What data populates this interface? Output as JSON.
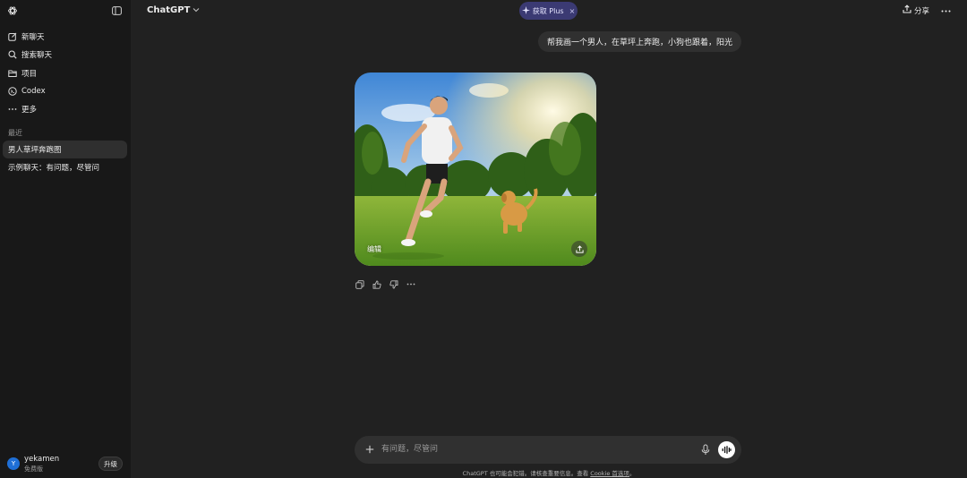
{
  "sidebar": {
    "nav_items": [
      {
        "label": "新聊天",
        "icon": "edit-icon"
      },
      {
        "label": "搜索聊天",
        "icon": "search-icon"
      },
      {
        "label": "项目",
        "icon": "folder-icon"
      },
      {
        "label": "Codex",
        "icon": "codex-icon"
      },
      {
        "label": "更多",
        "icon": "more-icon"
      }
    ],
    "section_label": "最近",
    "chats": [
      {
        "label": "男人草坪奔跑图",
        "active": true
      },
      {
        "label": "示例聊天：有问题，尽管问",
        "active": false
      }
    ],
    "user": {
      "avatar_initial": "Y",
      "name": "yekamen",
      "plan": "免费版",
      "upgrade_label": "升级"
    }
  },
  "header": {
    "model_label": "ChatGPT",
    "plus_pill_label": "获取 Plus",
    "plus_pill_close": "×",
    "share_label": "分享"
  },
  "conversation": {
    "user_message": "帮我画一个男人，在草坪上奔跑，小狗也跟着，阳光",
    "image_edit_label": "编辑"
  },
  "composer": {
    "placeholder": "有问题，尽管问"
  },
  "footer": {
    "disclaimer_prefix": "ChatGPT 也可能会犯错。请核查重要信息。查看 ",
    "disclaimer_link": "Cookie 首选项",
    "disclaimer_suffix": "。"
  },
  "colors": {
    "background": "#212121",
    "sidebar": "#181818",
    "plus_pill": "#3b3a73",
    "avatar": "#1f6fd6"
  }
}
